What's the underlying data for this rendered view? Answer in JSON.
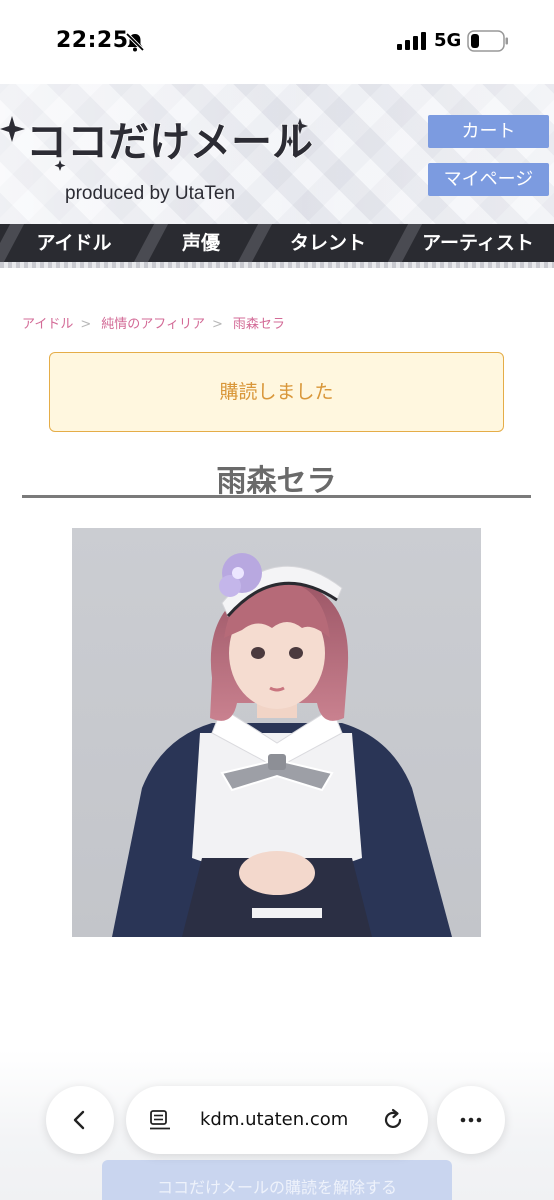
{
  "status_bar": {
    "time": "22:25",
    "network": "5G"
  },
  "header": {
    "logo_text": "ココだけメール",
    "logo_subtext": "produced by UtaTen",
    "cart_label": "カート",
    "mypage_label": "マイページ"
  },
  "nav": {
    "items": [
      {
        "label": "アイドル"
      },
      {
        "label": "声優"
      },
      {
        "label": "タレント"
      },
      {
        "label": "アーティスト"
      }
    ]
  },
  "breadcrumb": {
    "items": [
      {
        "label": "アイドル"
      },
      {
        "label": "純情のアフィリア"
      },
      {
        "label": "雨森セラ"
      }
    ],
    "separator": ">"
  },
  "notice": {
    "message": "購読しました"
  },
  "profile": {
    "name": "雨森セラ"
  },
  "actions": {
    "unsubscribe_label": "ココだけメールの購読を解除する"
  },
  "browser": {
    "url": "kdm.utaten.com"
  },
  "colors": {
    "accent_button": "#7c9be0",
    "nav_background": "#2a2b31",
    "breadcrumb_link": "#d36b97",
    "notice_background": "#fff7df",
    "notice_border": "#e5ad48",
    "notice_text": "#d9973a"
  },
  "icons": {
    "status": [
      "silent-bell-icon",
      "signal-bars-icon",
      "battery-icon"
    ],
    "browser": [
      "back-icon",
      "reader-mode-icon",
      "reload-icon",
      "more-icon"
    ]
  }
}
